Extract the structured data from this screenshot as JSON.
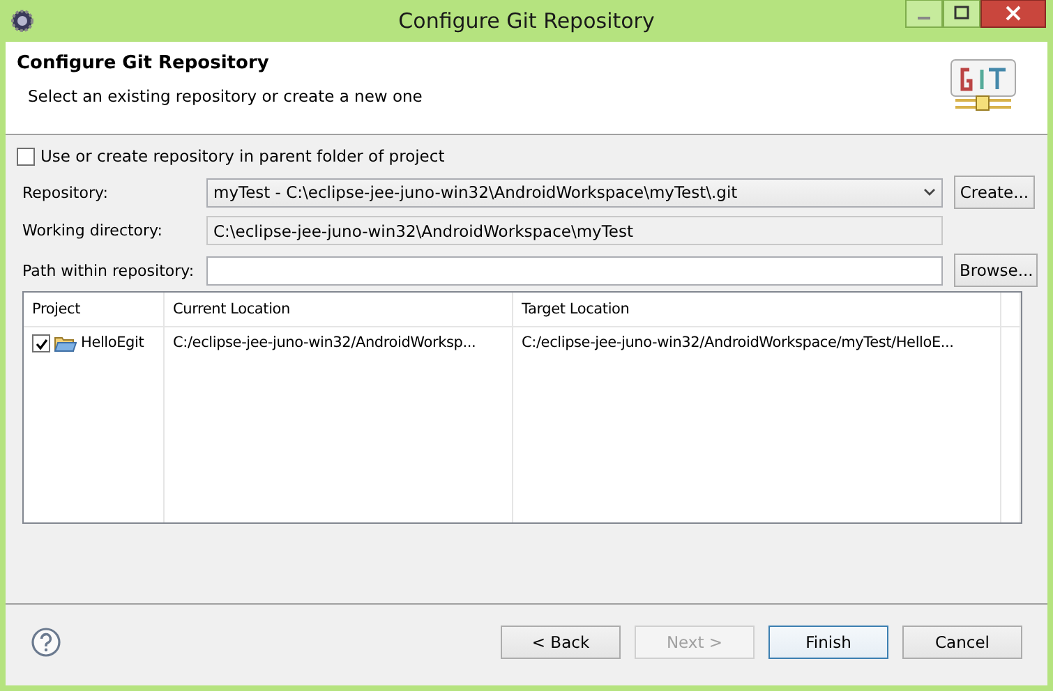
{
  "window": {
    "title": "Configure Git Repository"
  },
  "header": {
    "title": "Configure Git Repository",
    "subtitle": "Select an existing repository or create a new one"
  },
  "parent_folder_option": {
    "label": "Use or create repository in parent folder of project",
    "checked": false
  },
  "fields": [
    {
      "kind": "combo",
      "label": "Repository:",
      "value": "myTest - C:\\eclipse-jee-juno-win32\\AndroidWorkspace\\myTest\\.git",
      "button": "Create..."
    },
    {
      "kind": "readonly",
      "label": "Working directory:",
      "value": "C:\\eclipse-jee-juno-win32\\AndroidWorkspace\\myTest"
    },
    {
      "kind": "text",
      "label": "Path within repository:",
      "button": "Browse..."
    }
  ],
  "table": {
    "columns": [
      "Project",
      "Current Location",
      "Target Location"
    ],
    "rows": [
      {
        "checked": true,
        "cells": [
          "HelloEgit",
          "C:/eclipse-jee-juno-win32/AndroidWorksp...",
          "C:/eclipse-jee-juno-win32/AndroidWorkspace/myTest/HelloE..."
        ]
      }
    ]
  },
  "buttons": [
    {
      "label": "< Back",
      "disabled": false,
      "default": false
    },
    {
      "label": "Next >",
      "disabled": true,
      "default": false
    },
    {
      "label": "Finish",
      "disabled": false,
      "default": true
    },
    {
      "label": "Cancel",
      "disabled": false,
      "default": false
    }
  ]
}
